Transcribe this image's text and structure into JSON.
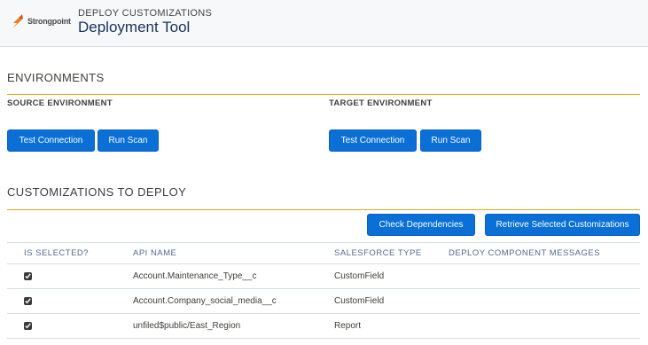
{
  "header": {
    "logo_text": "Strongpoint",
    "eyebrow": "DEPLOY CUSTOMIZATIONS",
    "title": "Deployment Tool"
  },
  "environments": {
    "title": "ENVIRONMENTS",
    "source": {
      "label": "SOURCE ENVIRONMENT",
      "test_connection": "Test Connection",
      "run_scan": "Run Scan"
    },
    "target": {
      "label": "TARGET ENVIRONMENT",
      "test_connection": "Test Connection",
      "run_scan": "Run Scan"
    }
  },
  "customizations": {
    "title": "CUSTOMIZATIONS TO DEPLOY",
    "check_dependencies": "Check Dependencies",
    "retrieve_selected": "Retrieve Selected Customizations",
    "columns": [
      "IS SELECTED?",
      "API NAME",
      "SALESFORCE TYPE",
      "DEPLOY COMPONENT MESSAGES"
    ],
    "rows": [
      {
        "selected": true,
        "api_name": "Account.Maintenance_Type__c",
        "type": "CustomField",
        "message": ""
      },
      {
        "selected": true,
        "api_name": "Account.Company_social_media__c",
        "type": "CustomField",
        "message": ""
      },
      {
        "selected": true,
        "api_name": "unfiled$public/East_Region",
        "type": "Report",
        "message": ""
      }
    ]
  },
  "colors": {
    "accent_rule": "#e4a91a",
    "button_blue": "#0a6fd6",
    "title_navy": "#16325c",
    "logo_orange": "#f07d22"
  }
}
